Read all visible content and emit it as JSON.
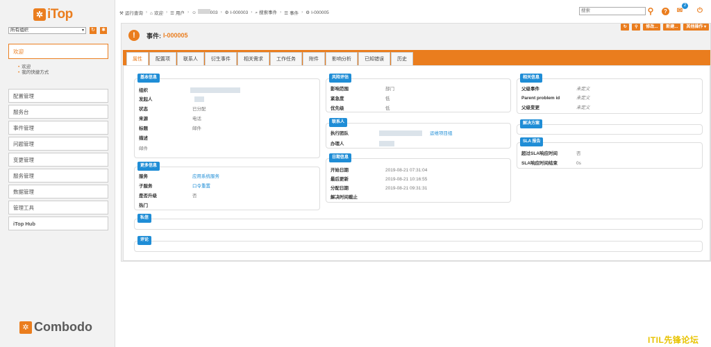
{
  "app": {
    "logo_text": "iTop",
    "logo_mark": "✲",
    "footer_logo_text": "Combodo",
    "footer_logo_mark": "✲"
  },
  "org": {
    "selected": "所有组织"
  },
  "sidebar": {
    "welcome": "欢迎",
    "sub_items": [
      "欢迎",
      "我的快捷方式"
    ],
    "items": [
      "配置管理",
      "服务台",
      "事件管理",
      "问题管理",
      "变更管理",
      "服务管理",
      "数据管理",
      "管理工具",
      "iTop Hub"
    ]
  },
  "breadcrumb": [
    "运行查询",
    "欢迎",
    "用户",
    "003",
    "I-000003",
    "搜索事件",
    "事件",
    "I-000005"
  ],
  "search": {
    "placeholder": "搜索"
  },
  "notifications": {
    "count": "2"
  },
  "toolbar": {
    "modify": "修改...",
    "new": "新建...",
    "other": "其他操作 ▾"
  },
  "title": {
    "label": "事件:",
    "ref": "I-000005",
    "icon": "!"
  },
  "tabs": [
    "属性",
    "配置项",
    "联系人",
    "衍生事件",
    "相关需求",
    "工作任务",
    "附件",
    "影响分析",
    "已知错误",
    "历史"
  ],
  "basic_info": {
    "title": "基本信息",
    "fields": [
      {
        "label": "组织",
        "value": ""
      },
      {
        "label": "发起人",
        "value": ""
      },
      {
        "label": "状态",
        "value": "已分配"
      },
      {
        "label": "来源",
        "value": "电话"
      },
      {
        "label": "标题",
        "value": "邮件"
      },
      {
        "label": "描述",
        "value": ""
      }
    ],
    "description_text": "邮件"
  },
  "more_info": {
    "title": "更多信息",
    "fields": [
      {
        "label": "服务",
        "value": "应用系统服务"
      },
      {
        "label": "子服务",
        "value": "口令重置"
      },
      {
        "label": "是否升级",
        "value": "否"
      },
      {
        "label": "热门",
        "value": ""
      }
    ]
  },
  "risk": {
    "title": "风险评估",
    "fields": [
      {
        "label": "影响范围",
        "value": "部门"
      },
      {
        "label": "紧急度",
        "value": "低"
      },
      {
        "label": "优先级",
        "value": "低"
      }
    ]
  },
  "contacts": {
    "title": "联系人",
    "fields": [
      {
        "label": "执行团队",
        "value": "运维项目组"
      },
      {
        "label": "办理人",
        "value": ""
      }
    ]
  },
  "dates": {
    "title": "日期信息",
    "fields": [
      {
        "label": "开始日期",
        "value": "2019-08-21 07:31:04"
      },
      {
        "label": "最后更新",
        "value": "2019-08-21 10:16:55"
      },
      {
        "label": "分配日期",
        "value": "2019-08-21 09:31:31"
      },
      {
        "label": "解决时间截止",
        "value": ""
      }
    ]
  },
  "related": {
    "title": "相关信息",
    "fields": [
      {
        "label": "父级事件",
        "value": "未定义"
      },
      {
        "label": "Parent problem id",
        "value": "未定义"
      },
      {
        "label": "父级变更",
        "value": "未定义"
      }
    ]
  },
  "solution": {
    "title": "解决方案"
  },
  "sla": {
    "title": "SLA 报告",
    "fields": [
      {
        "label": "超过SLA响应时间",
        "value": "否"
      },
      {
        "label": "SLA响应时间结束",
        "value": "0s"
      }
    ]
  },
  "private": {
    "title": "私信"
  },
  "comments": {
    "title": "评论"
  },
  "watermark": "ITIL先锋论坛"
}
